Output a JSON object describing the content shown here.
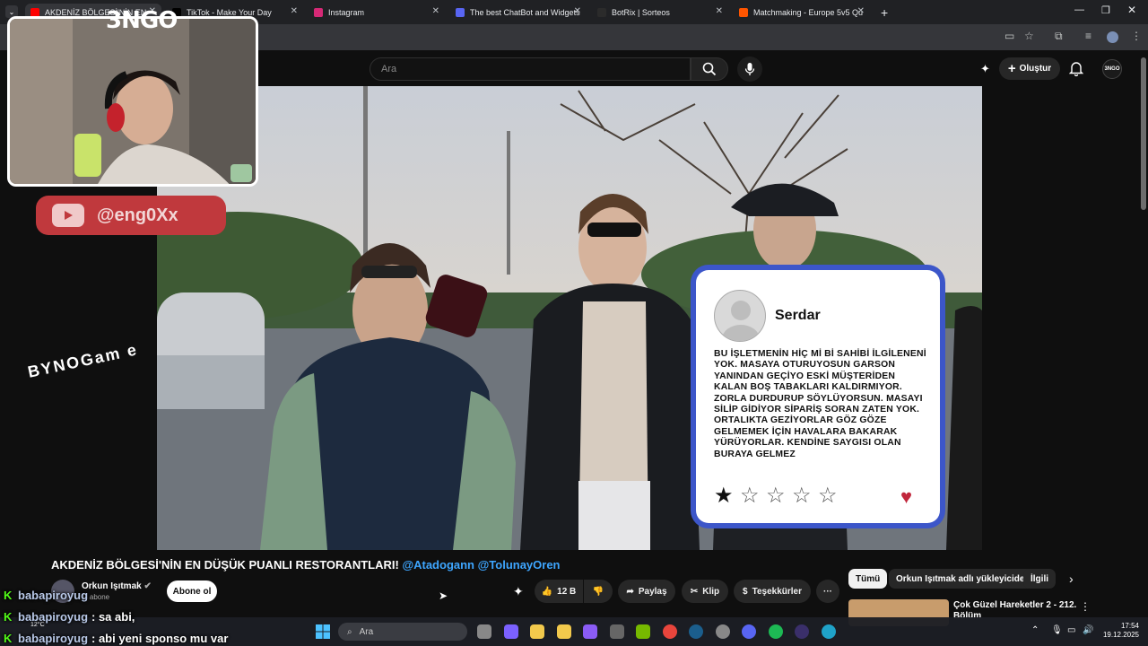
{
  "browser": {
    "tabs": [
      {
        "label": "AKDENİZ BÖLGESİ'NİN EN",
        "color": "#ff0000"
      },
      {
        "label": "TikTok - Make Your Day",
        "color": "#000000"
      },
      {
        "label": "Instagram",
        "color": "#d62976"
      },
      {
        "label": "The best ChatBot and Widgets",
        "color": "#5865f2"
      },
      {
        "label": "BotRix | Sorteos",
        "color": "#2b2b2b"
      },
      {
        "label": "Matchmaking - Europe 5v5 Qu",
        "color": "#ff5500"
      }
    ],
    "new_tab": "+"
  },
  "youtube": {
    "search_placeholder": "Ara",
    "create_label": "Oluştur"
  },
  "overlay": {
    "logo": "3NGO",
    "handle": "@eng0Xx",
    "watermark": "BYNOGam e"
  },
  "review_card": {
    "name": "Serdar",
    "text": "BU İŞLETMENİN HİÇ Mİ Bİ SAHİBİ İLGİLENENİ YOK. MASAYA OTURUYOSUN GARSON YANINDAN GEÇİYO ESKİ MÜŞTERİDEN KALAN BOŞ TABAKLARI KALDIRMIYOR. ZORLA DURDURUP SÖYLÜYORSUN. MASAYI SİLİP GİDİYOR SİPARİŞ SORAN ZATEN YOK. ORTALIKTA GEZİYORLAR GÖZ GÖZE GELMEMEK İÇİN HAVALARA BAKARAK YÜRÜYORLAR. KENDİNE SAYGISI OLAN BURAYA GELMEZ",
    "rating": 1,
    "max_rating": 5,
    "star_filled": "★",
    "star_empty": "☆",
    "heart": "♥"
  },
  "video": {
    "title_main": "AKDENİZ BÖLGESİ'NİN EN DÜŞÜK PUANLI RESTORANTLARI!",
    "title_tags": "@Atadogann @TolunayOren",
    "channel": "Orkun Işıtmak",
    "subscribers": "M abone",
    "subscribe_label": "Abone ol",
    "likes": "12 B",
    "share_label": "Paylaş",
    "clip_label": "Klip",
    "thanks_label": "Teşekkürler",
    "more_label": "···"
  },
  "sidebar": {
    "chips": [
      "Tümü",
      "Orkun Işıtmak adlı yükleyiciden",
      "İlgili"
    ],
    "recommended_title": "Çok Güzel Hareketler 2 - 212. Bölüm"
  },
  "chat": [
    {
      "user": "babapiroyug",
      "message": ""
    },
    {
      "user": "babapiroyug",
      "message": ": sa abi,"
    },
    {
      "user": "babapiroyug",
      "message": ": abi yeni sponso mu var"
    }
  ],
  "taskbar": {
    "search_placeholder": "Ara",
    "weather": "12°C",
    "time": "17:54",
    "date": "19.12.2025"
  }
}
